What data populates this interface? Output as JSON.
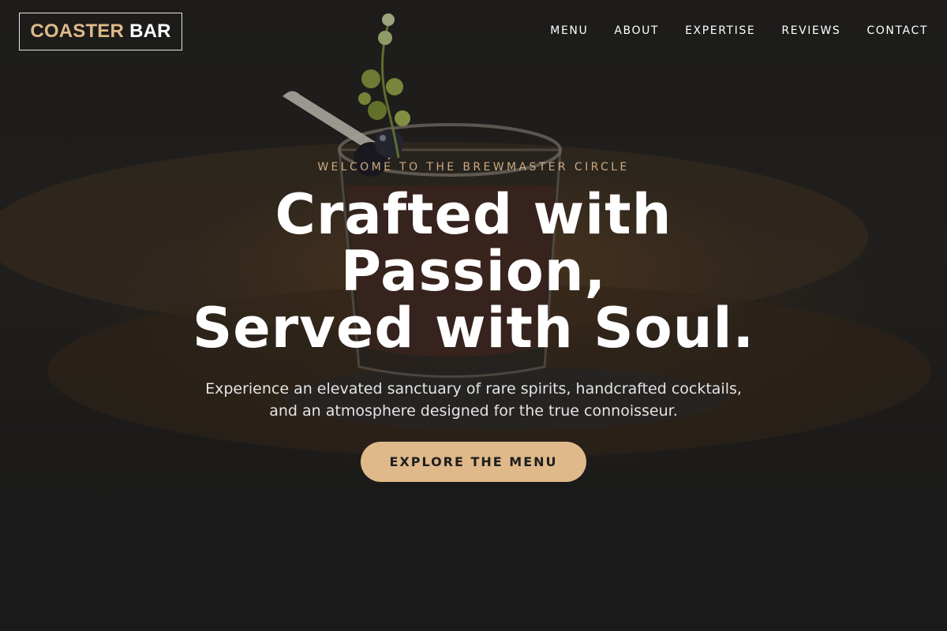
{
  "brand": {
    "name_accent": "COASTER",
    "name_plain": "BAR",
    "accent_color": "#dfb98a"
  },
  "nav": {
    "items": [
      {
        "label": "MENU"
      },
      {
        "label": "ABOUT"
      },
      {
        "label": "EXPERTISE"
      },
      {
        "label": "REVIEWS"
      },
      {
        "label": "CONTACT"
      }
    ]
  },
  "hero": {
    "eyebrow": "WELCOME TO THE BREWMASTER CIRCLE",
    "headline": {
      "line1": "Crafted with",
      "line2": "Passion,",
      "line3": "Served with Soul."
    },
    "subtext": "Experience an elevated sanctuary of rare spirits, handcrafted cocktails, and an atmosphere designed for the true connoisseur.",
    "cta_label": "EXPLORE THE MENU",
    "background_image": "cocktail-glass-with-herb-garnish"
  }
}
